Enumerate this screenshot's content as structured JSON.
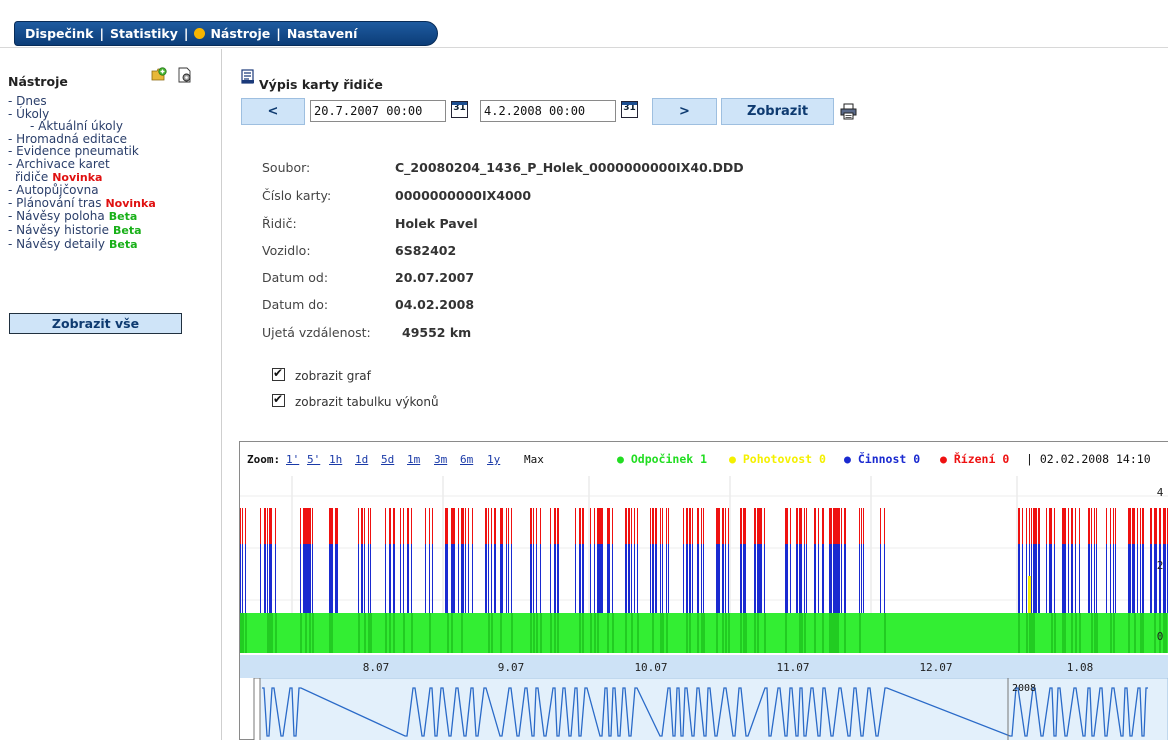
{
  "nav": {
    "items": [
      "Dispečink",
      "Statistiky",
      "Nástroje",
      "Nastavení"
    ],
    "active_index": 2,
    "separator": "|"
  },
  "sidebar": {
    "title": "Nástroje",
    "items": [
      {
        "label": "- Dnes"
      },
      {
        "label": "- Úkoly"
      },
      {
        "label": "- Aktuální úkoly",
        "sub": true
      },
      {
        "label": "- Hromadná editace"
      },
      {
        "label": "- Evidence pneumatik"
      },
      {
        "label": "- Archivace karet"
      },
      {
        "label": "řidiče",
        "badge": "Novinka"
      },
      {
        "label": "- Autopůjčovna"
      },
      {
        "label": "- Plánování tras",
        "badge": "Novinka"
      },
      {
        "label": "- Návěsy poloha",
        "badge": "Beta"
      },
      {
        "label": "- Návěsy historie",
        "badge": "Beta"
      },
      {
        "label": "- Návěsy detaily",
        "badge": "Beta"
      }
    ],
    "show_all": "Zobrazit vše"
  },
  "main": {
    "title": "Výpis karty řidiče",
    "prev_label": "<",
    "next_label": ">",
    "date_from": "20.7.2007 00:00",
    "date_to": "4.2.2008 00:00",
    "calendar_label": "31",
    "show_label": "Zobrazit"
  },
  "info": [
    {
      "label": "Soubor:",
      "value": "C_20080204_1436_P_Holek_0000000000IX40.DDD"
    },
    {
      "label": "Číslo karty:",
      "value": "0000000000IX4000"
    },
    {
      "label": "Řidič:",
      "value": "Holek Pavel"
    },
    {
      "label": "Vozidlo:",
      "value": "6S82402"
    },
    {
      "label": "Datum od:",
      "value": "20.07.2007"
    },
    {
      "label": "Datum do:",
      "value": "04.02.2008"
    },
    {
      "label": "Ujetá vzdálenost:",
      "value": "49552 km"
    }
  ],
  "options": [
    {
      "label": "zobrazit graf",
      "checked": true
    },
    {
      "label": "zobrazit tabulku výkonů",
      "checked": true
    }
  ],
  "chart": {
    "zoom_label": "Zoom:",
    "zoom_links": [
      "1'",
      "5'",
      "1h",
      "1d",
      "5d",
      "1m",
      "3m",
      "6m",
      "1y"
    ],
    "zoom_max": "Max",
    "legend": [
      {
        "label": "Odpočinek 1",
        "color": "#22dd22"
      },
      {
        "label": "Pohotovost 0",
        "color": "#f4f000"
      },
      {
        "label": "Činnost 0",
        "color": "#1a2ad0"
      },
      {
        "label": "Řízení 0",
        "color": "#ee1111"
      }
    ],
    "current": "| 02.02.2008 14:10",
    "x_labels": [
      "8.07",
      "9.07",
      "10.07",
      "11.07",
      "12.07",
      "1.08"
    ],
    "y_labels": [
      "4",
      "2",
      "0"
    ],
    "overview_year": "2008"
  }
}
